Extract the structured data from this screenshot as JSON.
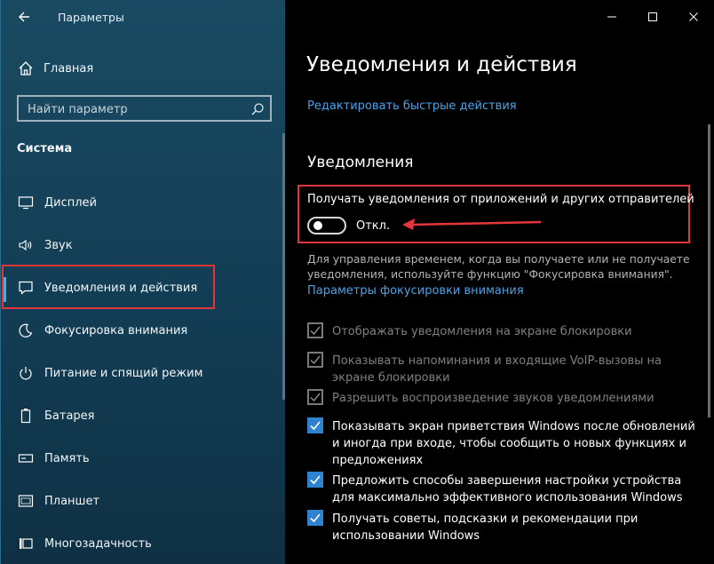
{
  "app": {
    "title": "Параметры"
  },
  "sidebar": {
    "home_label": "Главная",
    "search_placeholder": "Найти параметр",
    "section_title": "Система",
    "items": [
      {
        "label": "Дисплей",
        "icon": "monitor-icon"
      },
      {
        "label": "Звук",
        "icon": "speaker-icon"
      },
      {
        "label": "Уведомления и действия",
        "icon": "notification-icon",
        "selected": true
      },
      {
        "label": "Фокусировка внимания",
        "icon": "moon-icon"
      },
      {
        "label": "Питание и спящий режим",
        "icon": "power-icon"
      },
      {
        "label": "Батарея",
        "icon": "battery-icon"
      },
      {
        "label": "Память",
        "icon": "storage-icon"
      },
      {
        "label": "Планшет",
        "icon": "tablet-icon"
      },
      {
        "label": "Многозадачность",
        "icon": "multitask-icon"
      }
    ]
  },
  "main": {
    "title": "Уведомления и действия",
    "quick_actions_link": "Редактировать быстрые действия",
    "notifications_header": "Уведомления",
    "toggle_label": "Получать уведомления от приложений и других отправителей",
    "toggle_state": "Откл.",
    "toggle_on": false,
    "description": "Для управления временем, когда вы получаете или не получаете уведомления, используйте функцию \"Фокусировка внимания\".",
    "focus_link": "Параметры фокусировки внимания",
    "checkboxes": [
      {
        "text": "Отображать уведомления на экране блокировки",
        "checked": true,
        "enabled": false
      },
      {
        "text": "Показывать напоминания и входящие VoIP-вызовы на экране блокировки",
        "checked": true,
        "enabled": false
      },
      {
        "text": "Разрешить  воспроизведение звуков уведомлениями",
        "checked": true,
        "enabled": false
      },
      {
        "text": "Показывать экран приветствия Windows после обновлений и иногда при входе, чтобы сообщить о новых функциях и предложениях",
        "checked": true,
        "enabled": true
      },
      {
        "text": "Предложить способы завершения настройки устройства для максимально эффективного использования Windows",
        "checked": true,
        "enabled": true
      },
      {
        "text": "Получать советы, подсказки и рекомендации при использовании Windows",
        "checked": true,
        "enabled": true
      }
    ]
  },
  "colors": {
    "accent": "#2f82d0",
    "link": "#4aa3e8",
    "annotation_red": "#e2363a",
    "sidebar_bg": "#1a4a63"
  }
}
